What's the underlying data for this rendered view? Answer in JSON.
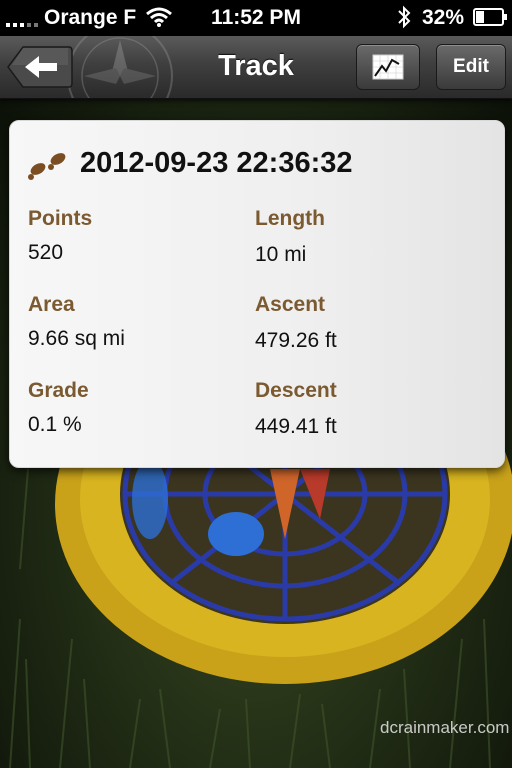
{
  "status_bar": {
    "carrier": "Orange F",
    "time": "11:52 PM",
    "battery_percent": "32%",
    "battery_level": 0.32
  },
  "nav": {
    "title": "Track",
    "edit_label": "Edit",
    "back_icon": "back-arrow-icon",
    "chart_icon": "chart-icon"
  },
  "track": {
    "title": "2012-09-23 22:36:32",
    "icon": "footprints-icon",
    "fields": {
      "points_label": "Points",
      "points_value": "520",
      "length_label": "Length",
      "length_value": "10 mi",
      "area_label": "Area",
      "area_value": "9.66 sq mi",
      "ascent_label": "Ascent",
      "ascent_value": "479.26 ft",
      "grade_label": "Grade",
      "grade_value": "0.1 %",
      "descent_label": "Descent",
      "descent_value": "449.41 ft"
    }
  },
  "watermark": "dcrainmaker.com",
  "colors": {
    "label_brown": "#7b5a32",
    "navbar": "#3f3f3f"
  }
}
